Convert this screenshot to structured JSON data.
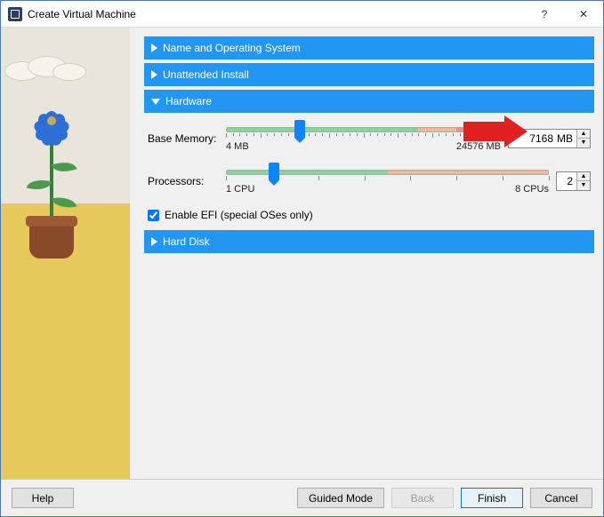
{
  "window": {
    "title": "Create Virtual Machine"
  },
  "sections": {
    "name_os": "Name and Operating System",
    "unattended": "Unattended Install",
    "hardware": "Hardware",
    "harddisk": "Hard Disk"
  },
  "hardware": {
    "memory_label": "Base Memory:",
    "memory_value": "7168",
    "memory_unit": "MB",
    "memory_min": "4 MB",
    "memory_max": "24576 MB",
    "memory_thumb_pct": 27,
    "memory_green_end_pct": 70,
    "memory_orange_end_pct": 84,
    "processors_label": "Processors:",
    "processors_value": "2",
    "processors_min": "1 CPU",
    "processors_max": "8 CPUs",
    "processors_thumb_pct": 15,
    "processors_green_end_pct": 50,
    "efi_label": "Enable EFI (special OSes only)",
    "efi_checked": true
  },
  "footer": {
    "help": "Help",
    "guided": "Guided Mode",
    "back": "Back",
    "finish": "Finish",
    "cancel": "Cancel"
  }
}
